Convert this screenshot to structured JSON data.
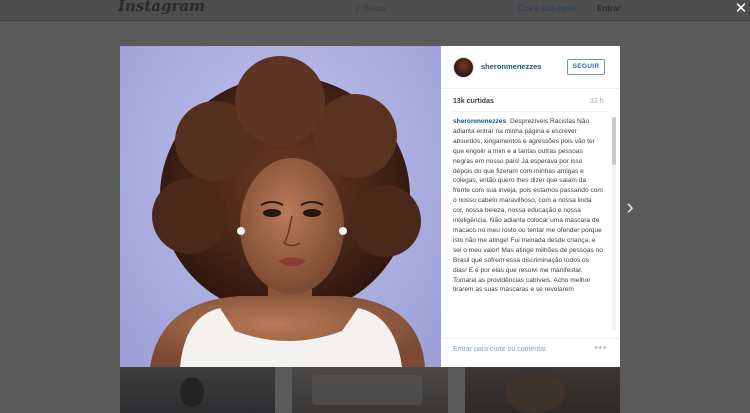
{
  "header": {
    "logo": "Instagram",
    "search_placeholder": "Busca",
    "signup_label": "Crie a sua conta",
    "login_label": "Entrar"
  },
  "icons": {
    "close": "close-icon",
    "next": "chevron-right-icon",
    "search": "search-icon",
    "more": "more-icon"
  },
  "post": {
    "username": "sheronmenezzes",
    "follow_label": "SEGUIR",
    "likes": "13k curtidas",
    "time": "32 h",
    "caption_user": "sheronmenezzes",
    "caption_text": "Desprezíveis Racistas Não adianta entrar na minha página e escrever absurdos, xingamentos e agressões pois vão ter que engolir a mim e a tantas outras pessoas negras em nosso país! Já esperava por isso depois do que fizeram com minhas amigas e colegas, então quero lhes dizer que saiam da frente com sua inveja, pois estamos passando com o nosso cabelo maravilhoso, com a nossa linda cor, nossa beleza, nossa educação e nossa inteligência. Não adianta colocar uma máscara de macaco no meu rosto ou tentar me ofender porque isto não me atinge! Fui treinada desde criança, e sei o meu valor! Mas atinge milhões de pessoas no Brasil que sofrem essa discriminação todos os dias! E é por elas que resolvi me manifestar. Tomarei as providências cabíveis. Acho melhor tirarem as suas máscaras e se revelarem",
    "comment_prompt": "Entrar para curtir ou comentar.",
    "more_label": "•••"
  },
  "colors": {
    "link": "#125688",
    "overlay": "#5a5a5a",
    "photo_bg": "#a9acde"
  }
}
